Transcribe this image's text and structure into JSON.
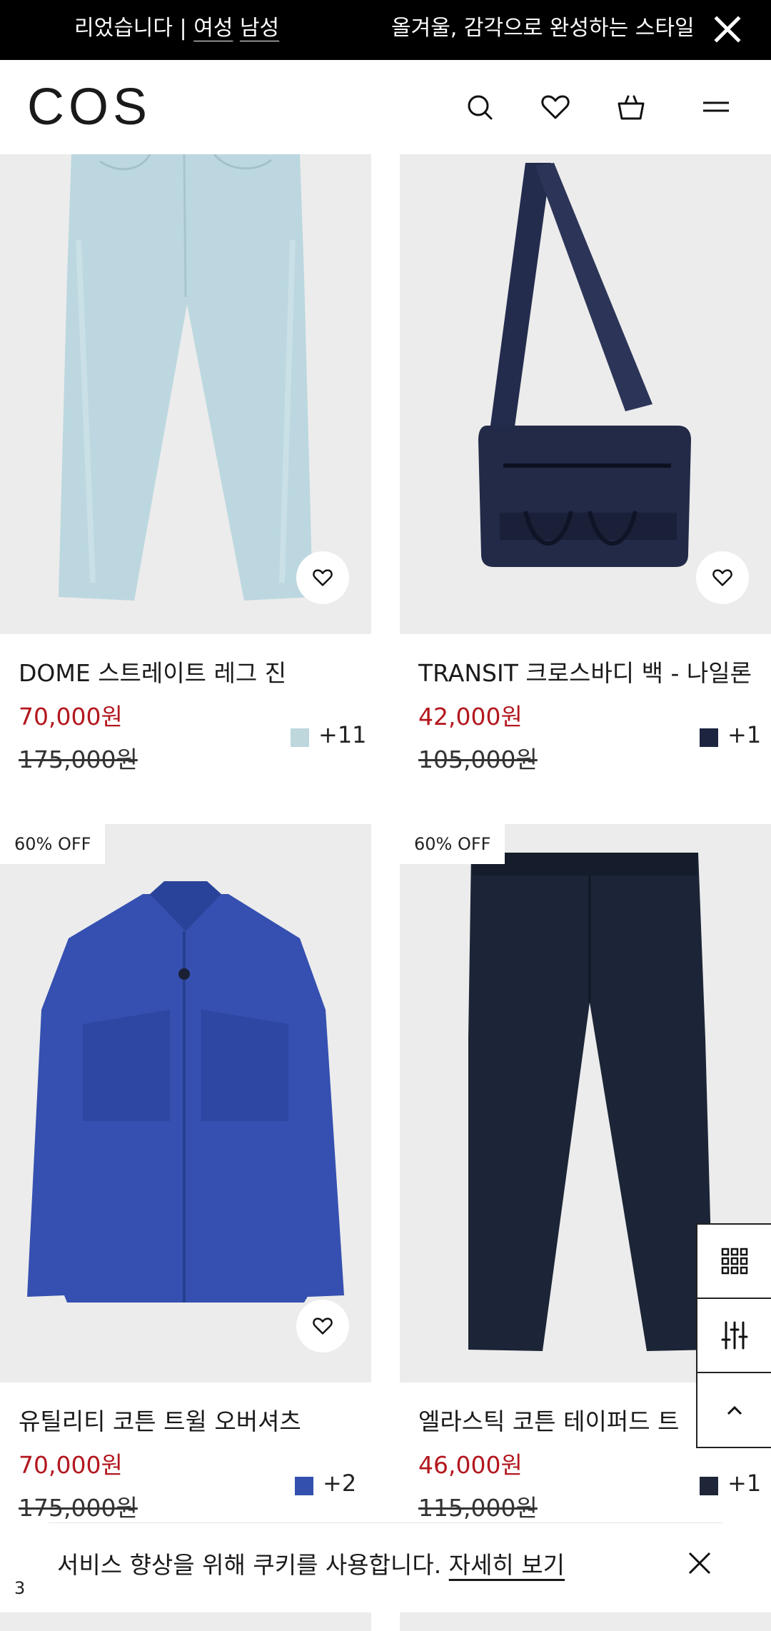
{
  "announcement": {
    "message_1_prefix": "리었습니다 | ",
    "link_women": "여성",
    "link_men": "남성",
    "message_2": "올겨울, 감각으로 완성하는 스타일"
  },
  "header": {
    "logo": "COS",
    "icons": [
      "search-icon",
      "heart-icon",
      "bag-icon",
      "menu-icon"
    ]
  },
  "products": [
    {
      "name": "DOME 스트레이트 레그 진",
      "sale_price": "70,000원",
      "original_price": "175,000원",
      "swatch_color": "#bdd7dc",
      "more_colors": "+11",
      "badge": ""
    },
    {
      "name": "TRANSIT 크로스바디 백 - 나일론",
      "sale_price": "42,000원",
      "original_price": "105,000원",
      "swatch_color": "#1d2440",
      "more_colors": "+1",
      "badge": ""
    },
    {
      "name": "유틸리티 코튼 트윌 오버셔츠",
      "sale_price": "70,000원",
      "original_price": "175,000원",
      "swatch_color": "#3350ae",
      "more_colors": "+2",
      "badge": "60% OFF"
    },
    {
      "name": "엘라스틱 코튼 테이퍼드 트",
      "sale_price": "46,000원",
      "original_price": "115,000원",
      "swatch_color": "#1e2638",
      "more_colors": "+1",
      "badge": "60% OFF"
    }
  ],
  "partial_badge": "3",
  "side_tools": [
    "grid-view-icon",
    "filter-sliders-icon",
    "chevron-up-icon"
  ],
  "cookie": {
    "text": "서비스 향상을 위해 쿠키를 사용합니다. ",
    "link": "자세히 보기"
  },
  "colors": {
    "sale_red": "#b3171e",
    "black": "#000000",
    "image_bg": "#ececec"
  }
}
